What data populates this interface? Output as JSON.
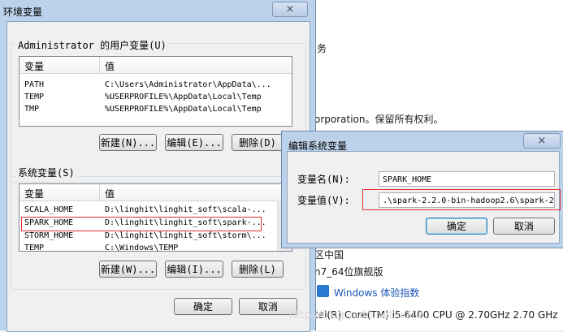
{
  "background_window": {
    "lines": [
      "务",
      "orporation。保留所有权利。",
      "区中国",
      "n7_64位旗舰版",
      "Windows 体验指数",
      "tel(R) Core(TM) i5-6400 CPU @ 2.70GHz  2.70 GHz"
    ]
  },
  "env_window": {
    "title": "环境变量",
    "close_icon": "×",
    "user_group_title": "Administrator 的用户变量(U)",
    "columns": [
      "变量",
      "值"
    ],
    "user_vars": [
      {
        "name": "PATH",
        "value": "C:\\Users\\Administrator\\AppData\\..."
      },
      {
        "name": "TEMP",
        "value": "%USERPROFILE%\\AppData\\Local\\Temp"
      },
      {
        "name": "TMP",
        "value": "%USERPROFILE%\\AppData\\Local\\Temp"
      }
    ],
    "user_buttons": {
      "new": "新建(N)...",
      "edit": "编辑(E)...",
      "delete": "删除(D)"
    },
    "system_group_title": "系统变量(S)",
    "system_vars": [
      {
        "name": "SCALA_HOME",
        "value": "D:\\linghit\\linghit_soft\\scala-..."
      },
      {
        "name": "SPARK_HOME",
        "value": "D:\\linghit\\linghit_soft\\spark-..."
      },
      {
        "name": "STORM_HOME",
        "value": "D:\\linghit\\linghit_soft\\storm\\..."
      },
      {
        "name": "TEMP",
        "value": "C:\\Windows\\TEMP"
      }
    ],
    "system_buttons": {
      "new": "新建(W)...",
      "edit": "编辑(I)...",
      "delete": "删除(L)"
    },
    "ok": "确定",
    "cancel": "取消"
  },
  "edit_dialog": {
    "title": "编辑系统变量",
    "close_icon": "×",
    "name_label": "变量名(N):",
    "name_value": "SPARK_HOME",
    "value_label": "变量值(V):",
    "value_value": ".\\spark-2.2.0-bin-hadoop2.6\\spark-2.",
    "ok": "确定",
    "cancel": "取消"
  },
  "watermark": "http://blog.csdn.net/u012..."
}
